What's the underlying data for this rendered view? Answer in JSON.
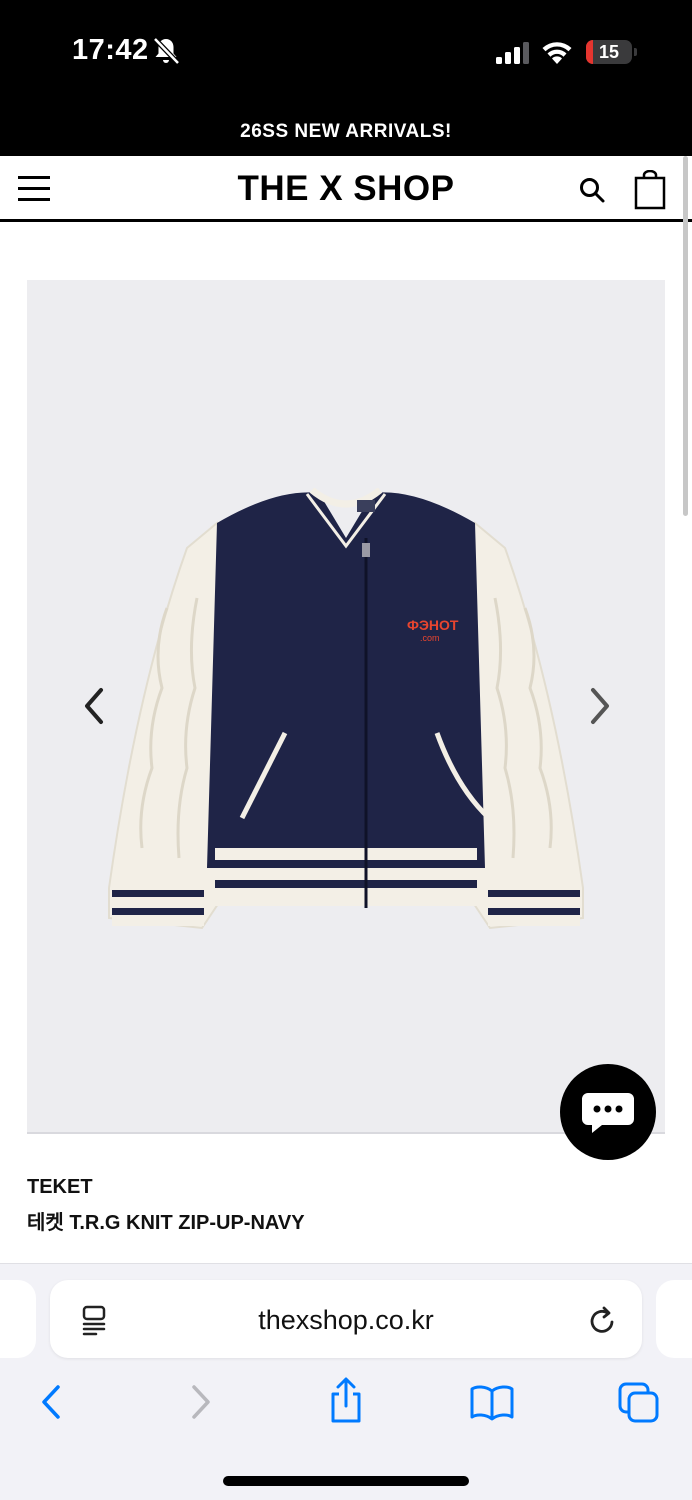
{
  "status_bar": {
    "time": "17:42",
    "battery_level": "15",
    "battery_fraction": 0.15,
    "icons": [
      "bell-slash-icon",
      "cellular-signal-icon",
      "wifi-icon",
      "battery-icon"
    ]
  },
  "promo": {
    "text": "26SS NEW ARRIVALS!"
  },
  "header": {
    "logo": "THE X SHOP",
    "icons": [
      "hamburger-menu-icon",
      "search-icon",
      "shopping-bag-icon"
    ]
  },
  "product": {
    "image_subject": "knit zip-up varsity cardigan, navy body with cream cable-knit sleeves",
    "brand": "TEKET",
    "name": "테켓 T.R.G KNIT ZIP-UP-NAVY",
    "carousel_icons": [
      "chevron-left-icon",
      "chevron-right-icon"
    ]
  },
  "chat": {
    "icon": "chat-bubble-icon"
  },
  "browser": {
    "url": "thexshop.co.kr",
    "icons": [
      "reader-mode-icon",
      "reload-icon",
      "back-arrow-icon",
      "forward-arrow-icon",
      "share-icon",
      "bookmarks-icon",
      "tabs-icon"
    ]
  },
  "colors": {
    "accent": "#000000",
    "image_bg": "#ededf0",
    "ios_blue": "#007aff",
    "battery_red": "#e5352f",
    "navy": "#1f2447",
    "cream": "#f3efe6"
  }
}
